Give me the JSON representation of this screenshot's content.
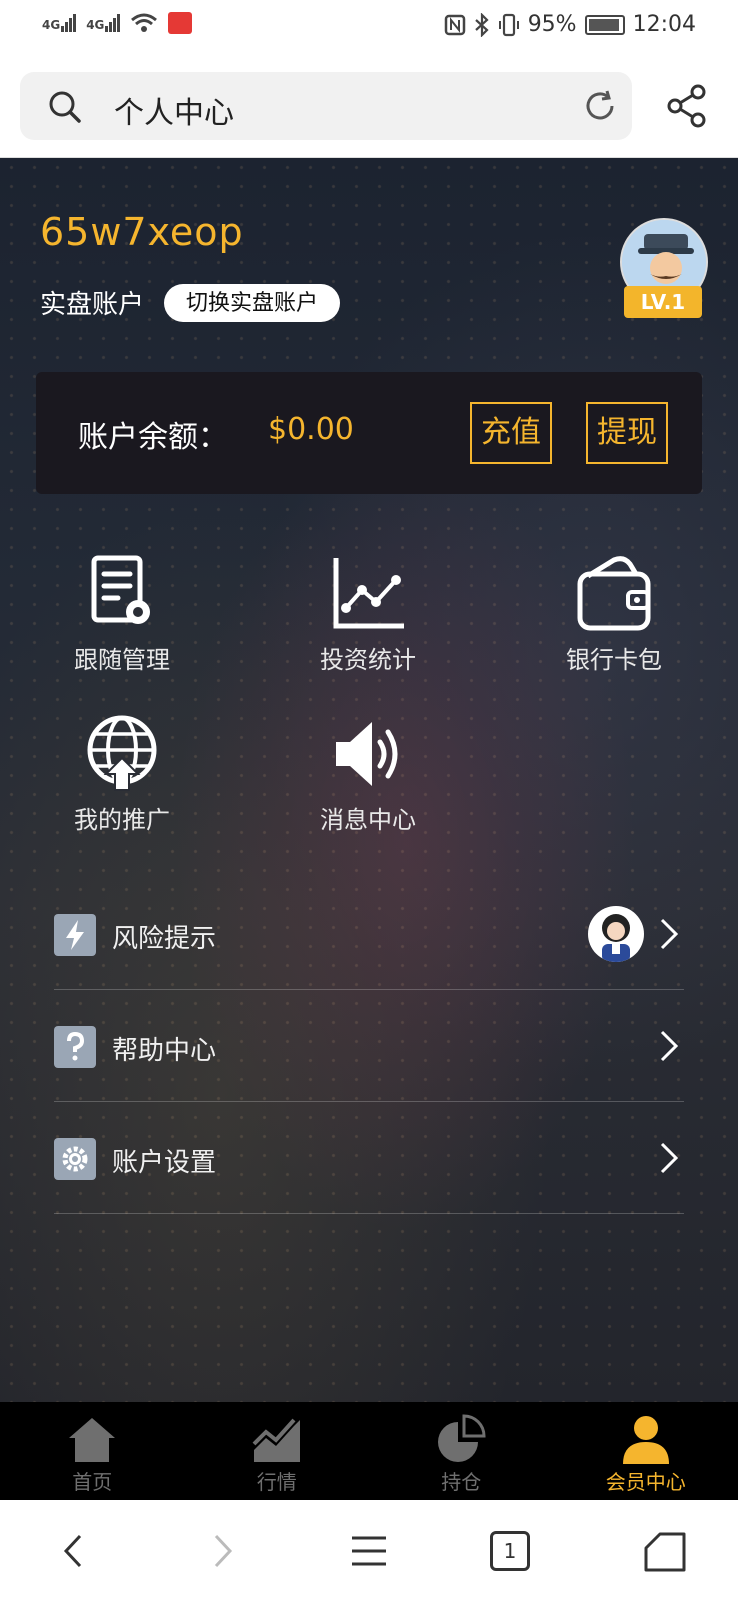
{
  "status_bar": {
    "signal_1": "4G",
    "signal_2": "4G",
    "battery": "95%",
    "time": "12:04"
  },
  "browser": {
    "title": "个人中心"
  },
  "profile": {
    "username": "65w7xeop",
    "account_type": "实盘账户",
    "switch_label": "切换实盘账户",
    "level": "LV.1"
  },
  "balance": {
    "label": "账户余额：",
    "value": "$0.00",
    "recharge": "充值",
    "withdraw": "提现"
  },
  "features": [
    {
      "label": "跟随管理",
      "icon": "document-gear-icon"
    },
    {
      "label": "投资统计",
      "icon": "line-chart-icon"
    },
    {
      "label": "银行卡包",
      "icon": "wallet-icon"
    },
    {
      "label": "我的推广",
      "icon": "globe-upload-icon"
    },
    {
      "label": "消息中心",
      "icon": "speaker-icon"
    }
  ],
  "menu": [
    {
      "label": "风险提示",
      "icon": "lightning-icon"
    },
    {
      "label": "帮助中心",
      "icon": "question-icon"
    },
    {
      "label": "账户设置",
      "icon": "settings-icon"
    }
  ],
  "tabs": [
    {
      "label": "首页",
      "icon": "home-icon"
    },
    {
      "label": "行情",
      "icon": "market-chart-icon"
    },
    {
      "label": "持仓",
      "icon": "pie-chart-icon"
    },
    {
      "label": "会员中心",
      "icon": "member-icon"
    }
  ],
  "system_nav": {
    "tab_count": "1"
  },
  "colors": {
    "accent": "#f5b52e",
    "tab_inactive": "#6f6f6f"
  }
}
